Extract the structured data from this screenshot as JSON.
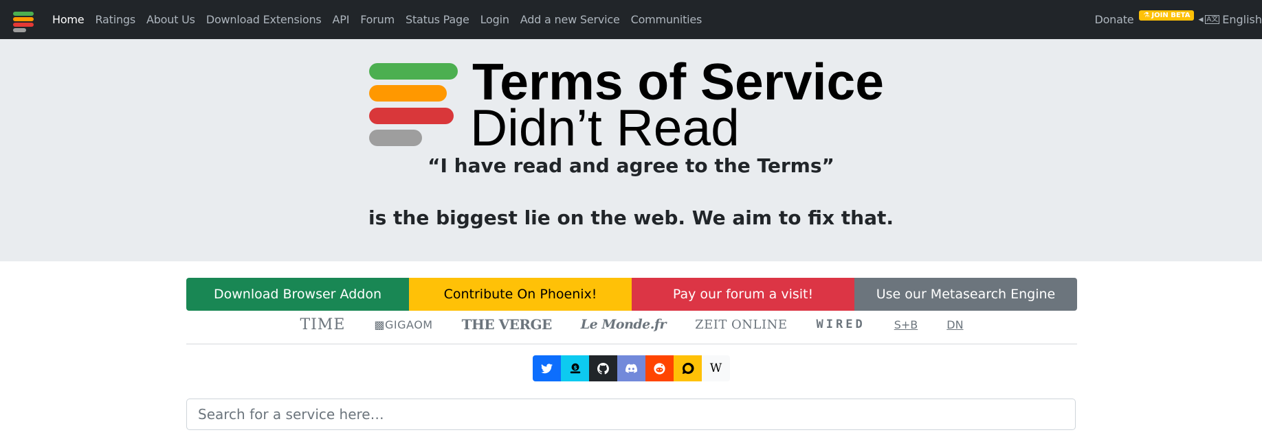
{
  "navbar": {
    "brand_colors": [
      "#4caf50",
      "#ff9800",
      "#e53935",
      "#9e9e9e"
    ],
    "links": [
      {
        "label": "Home",
        "active": true
      },
      {
        "label": "Ratings"
      },
      {
        "label": "About Us"
      },
      {
        "label": "Download Extensions"
      },
      {
        "label": "API"
      },
      {
        "label": "Forum"
      },
      {
        "label": "Status Page"
      },
      {
        "label": "Login"
      },
      {
        "label": "Add a new Service"
      },
      {
        "label": "Communities"
      }
    ],
    "donate": "Donate",
    "beta_badge": "JOIN BETA",
    "language": "English"
  },
  "hero": {
    "logo_line1": "Terms of Service",
    "logo_line2": "Didn’t Read",
    "logo_colors": [
      "#4caf50",
      "#ff9800",
      "#d9373a",
      "#9e9e9e"
    ],
    "quote": "“I have read and agree to the Terms”",
    "tagline": "is the biggest lie on the web. We aim to fix that."
  },
  "actions": [
    {
      "label": "Download Browser Addon",
      "bg": "#198754",
      "fg": "#ffffff"
    },
    {
      "label": "Contribute On Phoenix!",
      "bg": "#ffc107",
      "fg": "#000000"
    },
    {
      "label": "Pay our forum a visit!",
      "bg": "#dc3545",
      "fg": "#ffffff"
    },
    {
      "label": "Use our Metasearch Engine",
      "bg": "#6c757d",
      "fg": "#ffffff"
    }
  ],
  "press": {
    "time": "TIME",
    "gigaom": "GIGAOM",
    "verge": "THE VERGE",
    "lemonde": "Le Monde.fr",
    "zeit": "ZEIT ONLINE",
    "wired": "WIRED",
    "sb": "S+B",
    "dn": "DN"
  },
  "social": [
    {
      "name": "twitter",
      "bg": "#0d6efd"
    },
    {
      "name": "open-collective",
      "bg": "#0dcaf0"
    },
    {
      "name": "github",
      "bg": "#212529"
    },
    {
      "name": "discord",
      "bg": "#7289da"
    },
    {
      "name": "reddit",
      "bg": "#ff4500"
    },
    {
      "name": "discourse",
      "bg": "#ffc107"
    },
    {
      "name": "wikipedia",
      "bg": "#f8f9fa",
      "glyph": "W"
    }
  ],
  "search": {
    "placeholder": "Search for a service here…"
  }
}
